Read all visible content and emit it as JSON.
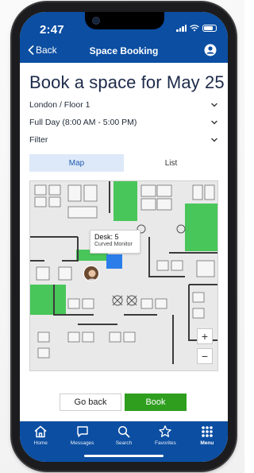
{
  "status_bar": {
    "time": "2:47"
  },
  "nav": {
    "back_label": "Back",
    "title": "Space Booking"
  },
  "page": {
    "title": "Book a space for May 25"
  },
  "selectors": [
    {
      "label": "London / Floor 1"
    },
    {
      "label": "Full Day (8:00 AM - 5:00 PM)"
    },
    {
      "label": "Filter"
    }
  ],
  "view_tabs": {
    "map": "Map",
    "list": "List",
    "active": "Map"
  },
  "map": {
    "tooltip_title": "Desk: 5",
    "tooltip_subtitle": "Curved Monitor",
    "zoom_in": "+",
    "zoom_out": "−",
    "colors": {
      "available": "#37c24a",
      "selected": "#2b7de9",
      "walls": "#3b3b3b"
    }
  },
  "actions": {
    "go_back": "Go back",
    "book": "Book"
  },
  "tabbar": [
    {
      "label": "Home",
      "icon": "home-icon"
    },
    {
      "label": "Messages",
      "icon": "messages-icon"
    },
    {
      "label": "Search",
      "icon": "search-icon"
    },
    {
      "label": "Favorites",
      "icon": "star-icon"
    },
    {
      "label": "Menu",
      "icon": "grid-icon"
    }
  ],
  "theme": {
    "brand": "#0b4ea2",
    "accent_green": "#2f9e1f",
    "active_tab_bg": "#dde9f8"
  }
}
